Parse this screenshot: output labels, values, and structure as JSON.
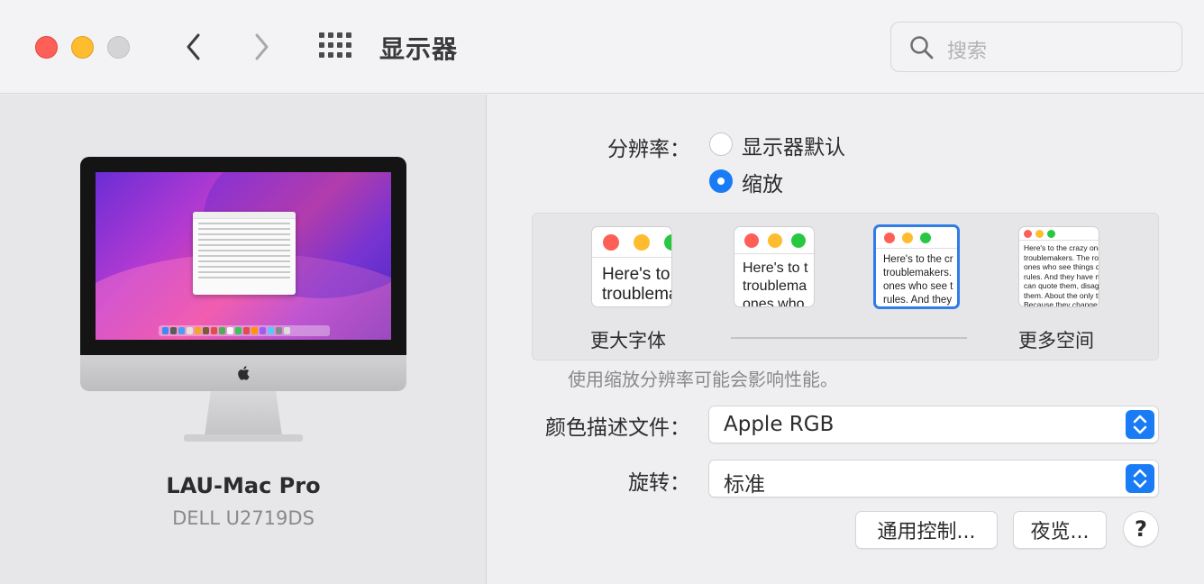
{
  "window": {
    "title": "显示器",
    "search_placeholder": "搜索"
  },
  "device": {
    "name": "LAU-Mac Pro",
    "model": "DELL U2719DS"
  },
  "resolution": {
    "label": "分辨率：",
    "options": [
      {
        "label": "显示器默认",
        "selected": false
      },
      {
        "label": "缩放",
        "selected": true
      }
    ],
    "scale_options": [
      {
        "lines": [
          "Here's to t",
          "troublema"
        ],
        "selected": false
      },
      {
        "lines": [
          "Here's to t",
          "troublema",
          "ones who"
        ],
        "selected": false
      },
      {
        "lines": [
          "Here's to the cr",
          "troublemakers.",
          "ones who see t",
          "rules. And they"
        ],
        "selected": true
      },
      {
        "lines": [
          "Here's to the crazy ones",
          "troublemakers. The rou",
          "ones who see things diff",
          "rules. And they have no",
          "can quote them, disagre",
          "them. About the only th",
          "Because they change th"
        ],
        "selected": false
      }
    ],
    "scale_left_label": "更大字体",
    "scale_right_label": "更多空间",
    "hint": "使用缩放分辨率可能会影响性能。"
  },
  "color_profile": {
    "label": "颜色描述文件：",
    "value": "Apple RGB"
  },
  "rotation": {
    "label": "旋转：",
    "value": "标准"
  },
  "buttons": {
    "universal_control": "通用控制...",
    "night_shift": "夜览...",
    "help": "?"
  },
  "colors": {
    "accent": "#1a7cf5",
    "close": "#fe5f57",
    "minimize": "#febc2e",
    "maximize_disabled": "#d4d3d6"
  }
}
